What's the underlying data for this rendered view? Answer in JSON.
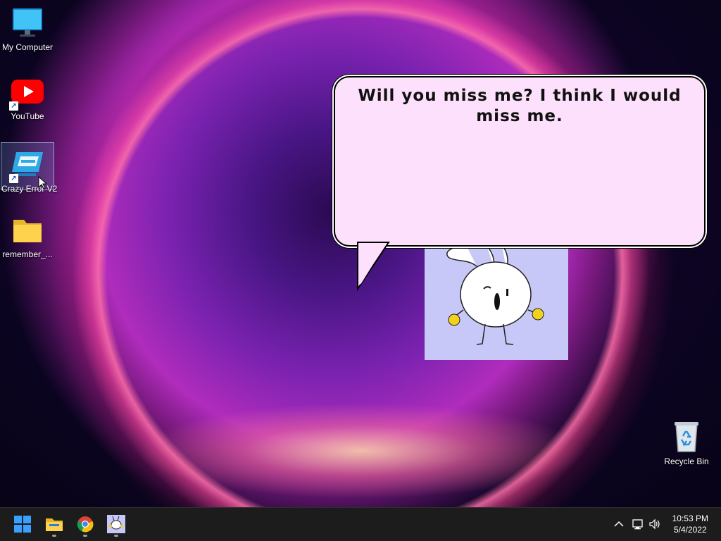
{
  "desktop": {
    "icons": [
      {
        "label": "My Computer"
      },
      {
        "label": "YouTube"
      },
      {
        "label": "Crazy Error V2"
      },
      {
        "label": "remember_..."
      },
      {
        "label": "Recycle Bin"
      }
    ]
  },
  "bubble": {
    "text": "Will you miss me? I think I would miss me."
  },
  "taskbar": {
    "apps": [
      "start-icon",
      "file-explorer-icon",
      "chrome-icon",
      "bunny-app-icon"
    ],
    "tray": {
      "time": "10:53 PM",
      "date": "5/4/2022"
    }
  },
  "colors": {
    "bubble_fill": "#fde0fb",
    "character_window": "#c8c8f8",
    "taskbar": "#1c1c1c"
  }
}
